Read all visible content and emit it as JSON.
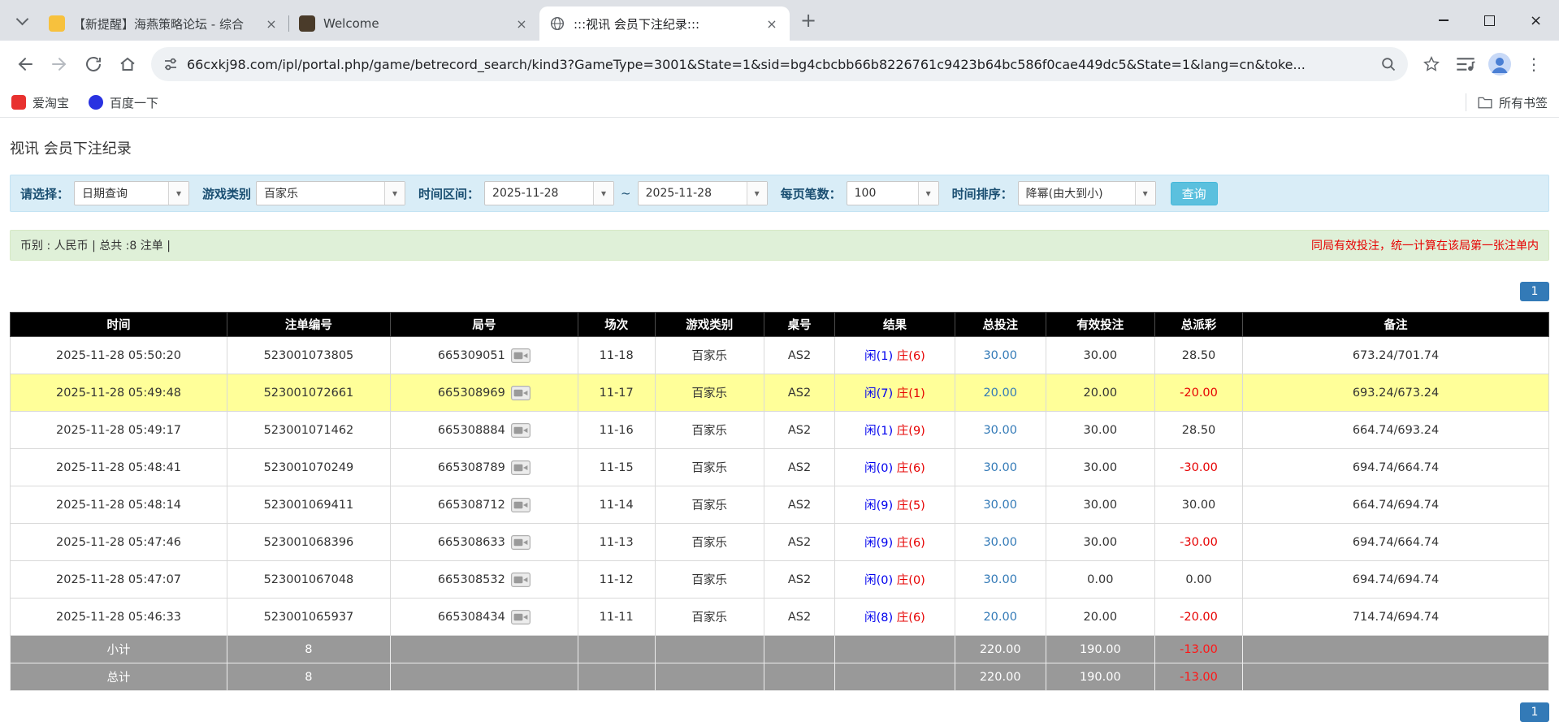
{
  "browser": {
    "tabs": [
      {
        "title": "【新提醒】海燕策略论坛 - 综合"
      },
      {
        "title": "Welcome"
      },
      {
        "title": ":::视讯 会员下注纪录:::"
      }
    ],
    "url": "66cxkj98.com/ipl/portal.php/game/betrecord_search/kind3?GameType=3001&State=1&sid=bg4cbcbb66b8226761c9423b64bc586f0cae449dc5&State=1&lang=cn&toke...",
    "bookmarks": [
      {
        "label": "爱淘宝"
      },
      {
        "label": "百度一下"
      }
    ],
    "all_bookmarks_label": "所有书签"
  },
  "icons": {
    "chevron_down": "▾",
    "close": "×",
    "new_tab": "+",
    "menu_dots": "⋮"
  },
  "page": {
    "title": "视讯 会员下注纪录",
    "filters": {
      "select_label": "请选择：",
      "select_value": "日期查询",
      "category_label": "游戏类别",
      "category_value": "百家乐",
      "range_label": "时间区间：",
      "date_from": "2025-11-28",
      "range_separator": "~",
      "date_to": "2025-11-28",
      "per_page_label": "每页笔数：",
      "per_page_value": "100",
      "sort_label": "时间排序：",
      "sort_value": "降幂(由大到小)",
      "search_button": "查询"
    },
    "summary": {
      "left": "币别 : 人民币 | 总共 :8 注单 |",
      "right": "同局有效投注，统一计算在该局第一张注单内"
    },
    "pagination": "1",
    "table": {
      "headers": [
        "时间",
        "注单编号",
        "局号",
        "场次",
        "游戏类别",
        "桌号",
        "结果",
        "总投注",
        "有效投注",
        "总派彩",
        "备注"
      ],
      "rows": [
        {
          "time": "2025-11-28 05:50:20",
          "bet_id": "523001073805",
          "round_id": "665309051",
          "session": "11-18",
          "game": "百家乐",
          "table_no": "AS2",
          "result_player": "闲(1)",
          "result_banker": "庄(6)",
          "total_bet": "30.00",
          "valid_bet": "30.00",
          "payout": "28.50",
          "payout_negative": false,
          "note": "673.24/701.74",
          "highlighted": false
        },
        {
          "time": "2025-11-28 05:49:48",
          "bet_id": "523001072661",
          "round_id": "665308969",
          "session": "11-17",
          "game": "百家乐",
          "table_no": "AS2",
          "result_player": "闲(7)",
          "result_banker": "庄(1)",
          "total_bet": "20.00",
          "valid_bet": "20.00",
          "payout": "-20.00",
          "payout_negative": true,
          "note": "693.24/673.24",
          "highlighted": true
        },
        {
          "time": "2025-11-28 05:49:17",
          "bet_id": "523001071462",
          "round_id": "665308884",
          "session": "11-16",
          "game": "百家乐",
          "table_no": "AS2",
          "result_player": "闲(1)",
          "result_banker": "庄(9)",
          "total_bet": "30.00",
          "valid_bet": "30.00",
          "payout": "28.50",
          "payout_negative": false,
          "note": "664.74/693.24",
          "highlighted": false
        },
        {
          "time": "2025-11-28 05:48:41",
          "bet_id": "523001070249",
          "round_id": "665308789",
          "session": "11-15",
          "game": "百家乐",
          "table_no": "AS2",
          "result_player": "闲(0)",
          "result_banker": "庄(6)",
          "total_bet": "30.00",
          "valid_bet": "30.00",
          "payout": "-30.00",
          "payout_negative": true,
          "note": "694.74/664.74",
          "highlighted": false
        },
        {
          "time": "2025-11-28 05:48:14",
          "bet_id": "523001069411",
          "round_id": "665308712",
          "session": "11-14",
          "game": "百家乐",
          "table_no": "AS2",
          "result_player": "闲(9)",
          "result_banker": "庄(5)",
          "total_bet": "30.00",
          "valid_bet": "30.00",
          "payout": "30.00",
          "payout_negative": false,
          "note": "664.74/694.74",
          "highlighted": false
        },
        {
          "time": "2025-11-28 05:47:46",
          "bet_id": "523001068396",
          "round_id": "665308633",
          "session": "11-13",
          "game": "百家乐",
          "table_no": "AS2",
          "result_player": "闲(9)",
          "result_banker": "庄(6)",
          "total_bet": "30.00",
          "valid_bet": "30.00",
          "payout": "-30.00",
          "payout_negative": true,
          "note": "694.74/664.74",
          "highlighted": false
        },
        {
          "time": "2025-11-28 05:47:07",
          "bet_id": "523001067048",
          "round_id": "665308532",
          "session": "11-12",
          "game": "百家乐",
          "table_no": "AS2",
          "result_player": "闲(0)",
          "result_banker": "庄(0)",
          "total_bet": "30.00",
          "valid_bet": "0.00",
          "payout": "0.00",
          "payout_negative": false,
          "note": "694.74/694.74",
          "highlighted": false
        },
        {
          "time": "2025-11-28 05:46:33",
          "bet_id": "523001065937",
          "round_id": "665308434",
          "session": "11-11",
          "game": "百家乐",
          "table_no": "AS2",
          "result_player": "闲(8)",
          "result_banker": "庄(6)",
          "total_bet": "20.00",
          "valid_bet": "20.00",
          "payout": "-20.00",
          "payout_negative": true,
          "note": "714.74/694.74",
          "highlighted": false
        }
      ],
      "subtotal": {
        "label": "小计",
        "count": "8",
        "total_bet": "220.00",
        "valid_bet": "190.00",
        "payout": "-13.00"
      },
      "total": {
        "label": "总计",
        "count": "8",
        "total_bet": "220.00",
        "valid_bet": "190.00",
        "payout": "-13.00"
      }
    }
  }
}
